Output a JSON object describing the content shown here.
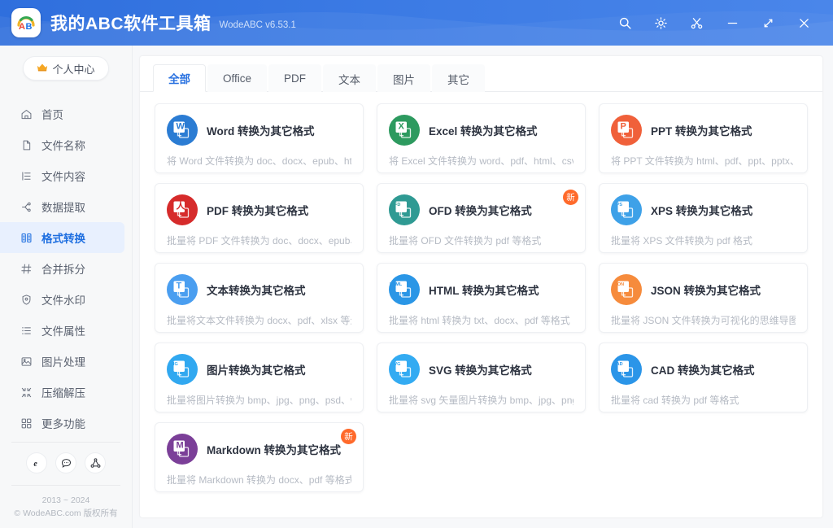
{
  "titlebar": {
    "logo_text": "AB",
    "title": "我的ABC软件工具箱",
    "version": "WodeABC v6.53.1",
    "buttons": [
      {
        "name": "search-button",
        "icon": "search-icon"
      },
      {
        "name": "settings-button",
        "icon": "gear-icon"
      },
      {
        "name": "screenshot-button",
        "icon": "scissors-icon"
      },
      {
        "name": "minimize-button",
        "icon": "minimize-icon"
      },
      {
        "name": "maximize-button",
        "icon": "maximize-icon"
      },
      {
        "name": "close-button",
        "icon": "close-icon"
      }
    ]
  },
  "sidebar": {
    "vip_label": "个人中心",
    "vip_icon": "crown-icon",
    "items": [
      {
        "label": "首页",
        "icon": "home-icon",
        "active": false
      },
      {
        "label": "文件名称",
        "icon": "file-name-icon",
        "active": false
      },
      {
        "label": "文件内容",
        "icon": "file-content-icon",
        "active": false
      },
      {
        "label": "数据提取",
        "icon": "data-extract-icon",
        "active": false
      },
      {
        "label": "格式转换",
        "icon": "format-convert-icon",
        "active": true
      },
      {
        "label": "合并拆分",
        "icon": "merge-split-icon",
        "active": false
      },
      {
        "label": "文件水印",
        "icon": "watermark-icon",
        "active": false
      },
      {
        "label": "文件属性",
        "icon": "file-props-icon",
        "active": false
      },
      {
        "label": "图片处理",
        "icon": "image-process-icon",
        "active": false
      },
      {
        "label": "压缩解压",
        "icon": "compress-icon",
        "active": false
      },
      {
        "label": "更多功能",
        "icon": "more-features-icon",
        "active": false
      }
    ],
    "social": [
      {
        "name": "browser-icon",
        "glyph": "e"
      },
      {
        "name": "chat-icon",
        "glyph": "…"
      },
      {
        "name": "share-icon",
        "glyph": "share"
      }
    ],
    "copyright_line1": "2013 ~ 2024",
    "copyright_line2": "© WodeABC.com 版权所有"
  },
  "tabs": [
    {
      "label": "全部",
      "active": true
    },
    {
      "label": "Office",
      "active": false
    },
    {
      "label": "PDF",
      "active": false
    },
    {
      "label": "文本",
      "active": false
    },
    {
      "label": "图片",
      "active": false
    },
    {
      "label": "其它",
      "active": false
    }
  ],
  "colors": {
    "brand": "#3b7ae4",
    "accent": "#2a72e0",
    "badge": "#ff6a2b",
    "word": "#2b7cd3",
    "excel": "#2d9a5f",
    "ppt": "#f0603a",
    "pdf": "#d62b2b",
    "ofd": "#2f9a93",
    "xps": "#3ea1e8",
    "text": "#4a9ef0",
    "html": "#2a96e6",
    "json": "#f68b3c",
    "image": "#31a8f0",
    "svg": "#33abf2",
    "cad": "#2b95e8",
    "markdown": "#7b3f98"
  },
  "cards": [
    {
      "title": "Word 转换为其它格式",
      "desc": "将 Word 文件转换为 doc、docx、epub、html、pd",
      "icon_label": "W",
      "icon_key": "word",
      "badge": ""
    },
    {
      "title": "Excel 转换为其它格式",
      "desc": "将 Excel 文件转换为 word、pdf、html、csv、txt、:",
      "icon_label": "X",
      "icon_key": "excel",
      "badge": ""
    },
    {
      "title": "PPT 转换为其它格式",
      "desc": "将 PPT 文件转换为 html、pdf、ppt、pptx、xps 等;",
      "icon_label": "P",
      "icon_key": "ppt",
      "badge": ""
    },
    {
      "title": "PDF 转换为其它格式",
      "desc": "批量将 PDF 文件转换为 doc、docx、epub、html、",
      "icon_label": "人",
      "icon_key": "pdf",
      "badge": ""
    },
    {
      "title": "OFD 转换为其它格式",
      "desc": "批量将 OFD 文件转换为 pdf 等格式",
      "icon_label": "OFD",
      "icon_key": "ofd",
      "badge": "新"
    },
    {
      "title": "XPS 转换为其它格式",
      "desc": "批量将 XPS 文件转换为 pdf 格式",
      "icon_label": "XPS",
      "icon_key": "xps",
      "badge": ""
    },
    {
      "title": "文本转换为其它格式",
      "desc": "批量将文本文件转换为 docx、pdf、xlsx 等众多格式",
      "icon_label": "T",
      "icon_key": "text",
      "badge": ""
    },
    {
      "title": "HTML 转换为其它格式",
      "desc": "批量将 html 转换为 txt、docx、pdf 等格式",
      "icon_label": "HTML",
      "icon_key": "html",
      "badge": ""
    },
    {
      "title": "JSON 转换为其它格式",
      "desc": "批量将 JSON 文件转换为可视化的思维导图或其它格",
      "icon_label": "JSON",
      "icon_key": "json",
      "badge": ""
    },
    {
      "title": "图片转换为其它格式",
      "desc": "批量将图片转换为 bmp、jpg、png、psd、webp、",
      "icon_label": "IMG",
      "icon_key": "image",
      "badge": ""
    },
    {
      "title": "SVG 转换为其它格式",
      "desc": "批量将 svg 矢量图片转换为 bmp、jpg、png、doc",
      "icon_label": "SVG",
      "icon_key": "svg",
      "badge": ""
    },
    {
      "title": "CAD 转换为其它格式",
      "desc": "批量将 cad 转换为 pdf 等格式",
      "icon_label": "CAD",
      "icon_key": "cad",
      "badge": ""
    },
    {
      "title": "Markdown 转换为其它格式",
      "desc": "批量将 Markdown 转换为 docx、pdf 等格式",
      "icon_label": "M",
      "icon_key": "markdown",
      "badge": "新"
    }
  ]
}
